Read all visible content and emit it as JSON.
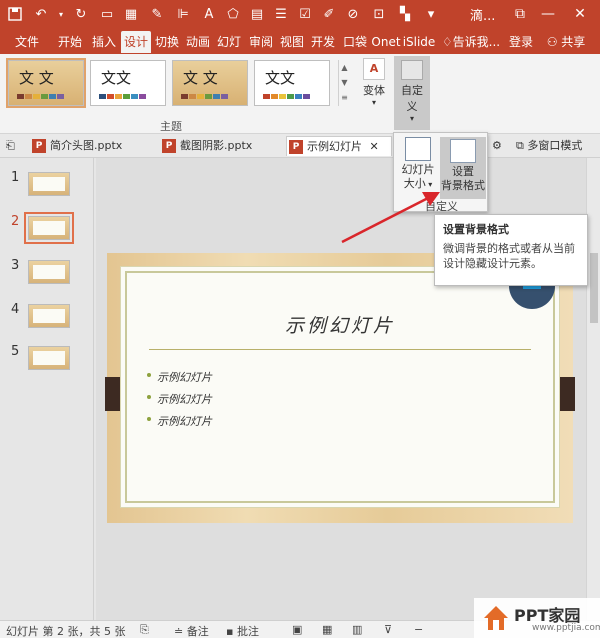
{
  "app": {
    "title_fragment": "滴...",
    "window": {
      "restore_icon": "restore-icon",
      "minimize_icon": "minimize-icon",
      "close_icon": "close-icon"
    }
  },
  "ribbon_tabs": [
    "文件",
    "开始",
    "插入",
    "设计",
    "切换",
    "动画",
    "幻灯片",
    "审阅",
    "视图",
    "开发",
    "口袋",
    "Onet",
    "iSlide"
  ],
  "ribbon_tabs_display": [
    "文件",
    "开始",
    "插入",
    "设计",
    "切换",
    "动画",
    "幻灯",
    "审阅",
    "视图",
    "开发",
    "口袋",
    "Onet",
    "iSlide"
  ],
  "active_tab": "设计",
  "tell_me": "告诉我...",
  "login": "登录",
  "share": "共享",
  "themes": {
    "group_label": "主题",
    "items": [
      {
        "text": "文 文",
        "style": "wood"
      },
      {
        "text": "文文",
        "style": "plain"
      },
      {
        "text": "文 文",
        "style": "wood"
      },
      {
        "text": "文文",
        "style": "plain"
      }
    ]
  },
  "variants_label": "变体",
  "custom": {
    "label_line1": "自定",
    "label_line2": "义"
  },
  "doc_tabs": [
    "简介头图.pptx",
    "截图阴影.pptx",
    "示例幻灯片"
  ],
  "multi_window": "多窗口模式",
  "dropdown": {
    "slide_size": {
      "line1": "幻灯片",
      "line2": "大小"
    },
    "format_bg": {
      "line1": "设置",
      "line2": "背景格式"
    },
    "group_label": "自定义"
  },
  "tooltip": {
    "title": "设置背景格式",
    "desc": "微调背景的格式或者从当前设计隐藏设计元素。"
  },
  "thumbnails": {
    "numbers": [
      "1",
      "2",
      "3",
      "4",
      "5"
    ],
    "current": "2"
  },
  "slide": {
    "title": "示例幻灯片",
    "bullets": [
      "示例幻灯片",
      "示例幻灯片",
      "示例幻灯片"
    ]
  },
  "status": {
    "slide_info": "幻灯片 第 2 张，共 5 张",
    "notes": "备注",
    "comments": "批注"
  },
  "watermark": {
    "name": "PPT家园",
    "url": "www.pptjia.com"
  },
  "colors": {
    "accent": "#c0432b",
    "arrow": "#d9262b"
  }
}
